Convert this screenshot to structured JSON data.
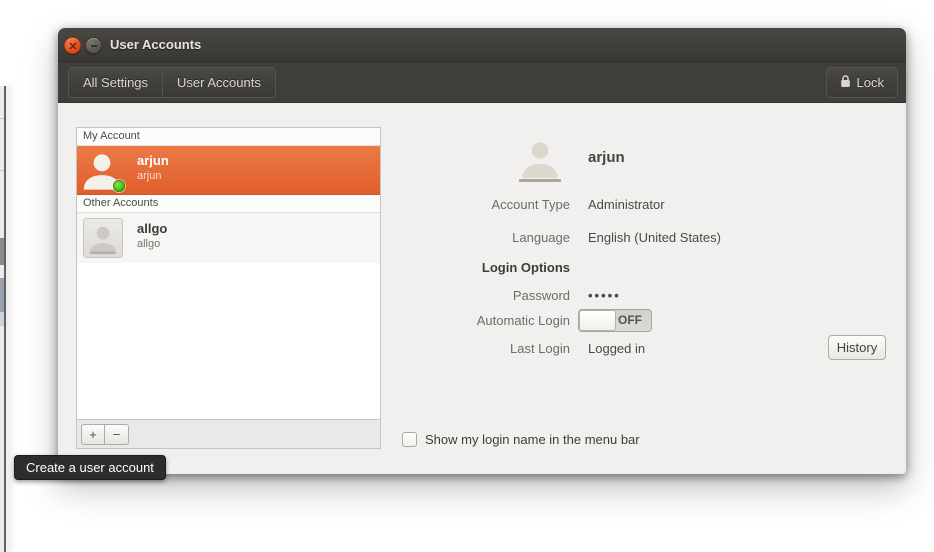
{
  "window": {
    "title": "User Accounts"
  },
  "toolbar": {
    "all_settings_label": "All Settings",
    "user_accounts_label": "User Accounts",
    "lock_label": "Lock"
  },
  "sidebar": {
    "my_account_header": "My Account",
    "other_accounts_header": "Other Accounts",
    "accounts": [
      {
        "name": "arjun",
        "username": "arjun",
        "selected": true,
        "online": true
      },
      {
        "name": "allgo",
        "username": "allgo",
        "selected": false,
        "online": false
      }
    ],
    "add_label": "+",
    "remove_label": "−"
  },
  "details": {
    "name": "arjun",
    "account_type_label": "Account Type",
    "account_type_value": "Administrator",
    "language_label": "Language",
    "language_value": "English (United States)",
    "login_options_header": "Login Options",
    "password_label": "Password",
    "password_value": "•••••",
    "auto_login_label": "Automatic Login",
    "auto_login_state": "OFF",
    "last_login_label": "Last Login",
    "last_login_value": "Logged in",
    "history_label": "History",
    "checkbox_label": "Show my login name in the menu bar",
    "checkbox_checked": false
  },
  "tooltip": {
    "text": "Create a user account"
  },
  "colors": {
    "accent_orange": "#E8683C",
    "titlebar": "#3E3C38",
    "online_green": "#3CB60E",
    "tooltip_bg": "#2D2D2D",
    "window_bg": "#F1F0EE"
  }
}
